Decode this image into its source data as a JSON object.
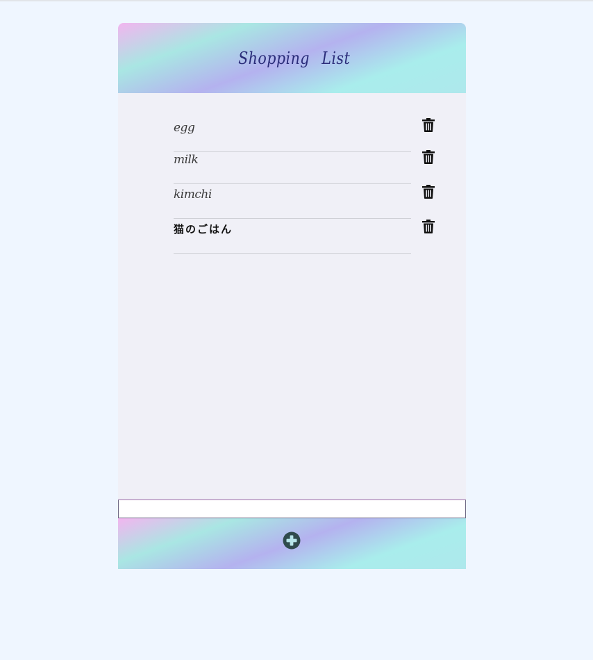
{
  "app": {
    "title": "Shopping List"
  },
  "items": [
    {
      "label": "egg",
      "lang": "en"
    },
    {
      "label": "milk",
      "lang": "en"
    },
    {
      "label": "kimchi",
      "lang": "en"
    },
    {
      "label": "猫のごはん",
      "lang": "ja"
    }
  ],
  "input": {
    "value": "",
    "placeholder": ""
  },
  "icons": {
    "delete": "trash-icon",
    "add": "plus-circle-icon"
  },
  "colors": {
    "page_background": "#eff6ff",
    "card_background": "#f0f0f7",
    "title": "#2b2d7a",
    "icon_dark": "#111111",
    "add_icon": "#2f4a4c"
  }
}
